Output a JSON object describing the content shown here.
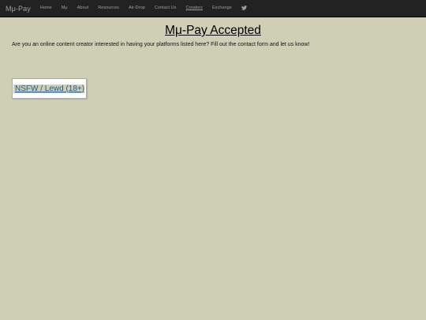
{
  "navbar": {
    "brand": "Mμ-Pay",
    "items": [
      {
        "label": "Home",
        "active": false
      },
      {
        "label": "Mμ",
        "active": false
      },
      {
        "label": "About",
        "active": false
      },
      {
        "label": "Resources",
        "active": false
      },
      {
        "label": "Air-Drop",
        "active": false
      },
      {
        "label": "Contact Us",
        "active": false
      },
      {
        "label": "Creators",
        "active": true
      },
      {
        "label": "Exchange",
        "active": false
      }
    ],
    "twitter_icon": "twitter-bird-icon"
  },
  "main": {
    "title": "Mμ-Pay Accepted",
    "intro": "Are you an online content creator interested in having your platforms listed here? Fill out the contact form and let us know!",
    "category_link": "NSFW / Lewd (18+)"
  },
  "colors": {
    "background": "#cfcfb6",
    "navbar": "#222222",
    "link": "#1f5a8a"
  }
}
